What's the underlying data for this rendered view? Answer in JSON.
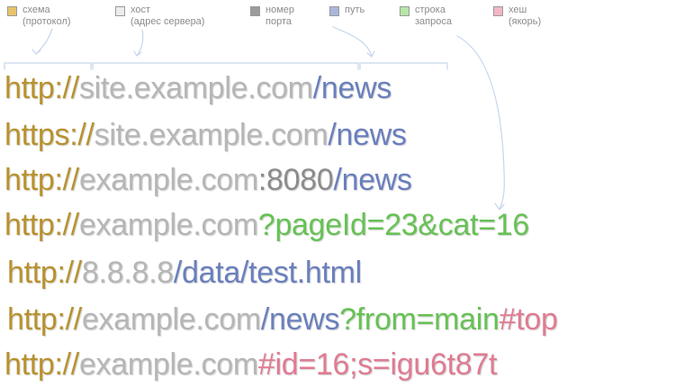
{
  "colors": {
    "scheme": "#e8c46a",
    "host": "#ececec",
    "port": "#9c9c9c",
    "path": "#a9b7dc",
    "query": "#b6e6a8",
    "hash": "#f2b7c4",
    "scheme_text": "#b8922e",
    "host_text": "#b6b6b6",
    "port_text": "#8c8c8c",
    "path_text": "#6a7fbd",
    "query_text": "#66c254",
    "hash_text": "#e07b92"
  },
  "legend": [
    {
      "key": "scheme",
      "line1": "схема",
      "line2": "(протокол)"
    },
    {
      "key": "host",
      "line1": "хост",
      "line2": "(адрес сервера)"
    },
    {
      "key": "port",
      "line1": "номер",
      "line2": "порта"
    },
    {
      "key": "path",
      "line1": "путь",
      "line2": ""
    },
    {
      "key": "query",
      "line1": "строка",
      "line2": "запроса"
    },
    {
      "key": "hash",
      "line1": "хеш",
      "line2": "(якорь)"
    }
  ],
  "urls": [
    [
      {
        "type": "scheme",
        "text": "http://"
      },
      {
        "type": "host",
        "text": "site.example.com"
      },
      {
        "type": "path",
        "text": "/news"
      }
    ],
    [
      {
        "type": "scheme",
        "text": "https://"
      },
      {
        "type": "host",
        "text": "site.example.com"
      },
      {
        "type": "path",
        "text": "/news"
      }
    ],
    [
      {
        "type": "scheme",
        "text": "http://"
      },
      {
        "type": "host",
        "text": "example.com"
      },
      {
        "type": "port",
        "text": ":8080"
      },
      {
        "type": "path",
        "text": "/news"
      }
    ],
    [
      {
        "type": "scheme",
        "text": "http://"
      },
      {
        "type": "host",
        "text": "example.com"
      },
      {
        "type": "query",
        "text": "?pageId=23&cat=16"
      }
    ],
    [
      {
        "type": "scheme",
        "text": "http://"
      },
      {
        "type": "host",
        "text": "8.8.8.8"
      },
      {
        "type": "path",
        "text": "/data/test.html"
      }
    ],
    [
      {
        "type": "scheme",
        "text": "http://"
      },
      {
        "type": "host",
        "text": "example.com"
      },
      {
        "type": "path",
        "text": "/news"
      },
      {
        "type": "query",
        "text": "?from=main"
      },
      {
        "type": "hash",
        "text": "#top"
      }
    ],
    [
      {
        "type": "scheme",
        "text": "http://"
      },
      {
        "type": "host",
        "text": "example.com"
      },
      {
        "type": "hash",
        "text": "#id=16;s=igu6t87t"
      }
    ]
  ]
}
